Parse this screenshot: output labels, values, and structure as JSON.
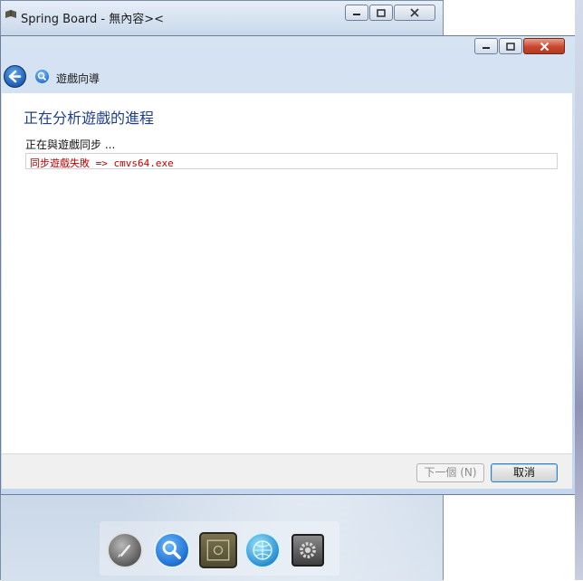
{
  "background_window": {
    "title": "Spring Board - 無內容><",
    "dock": {
      "icons": [
        "launcher-icon",
        "search-icon",
        "book-icon",
        "globe-icon",
        "settings-icon"
      ]
    }
  },
  "wizard": {
    "header_title": "遊戲向導",
    "heading": "正在分析遊戲的進程",
    "status": "正在與遊戲同步 ...",
    "log_lines": [
      "同步遊戲失敗 => cmvs64.exe"
    ],
    "buttons": {
      "next": "下一個 (N)",
      "cancel": "取消"
    }
  },
  "colors": {
    "heading": "#1f3f8a",
    "error_text": "#c00000",
    "close_button": "#c9462c"
  }
}
